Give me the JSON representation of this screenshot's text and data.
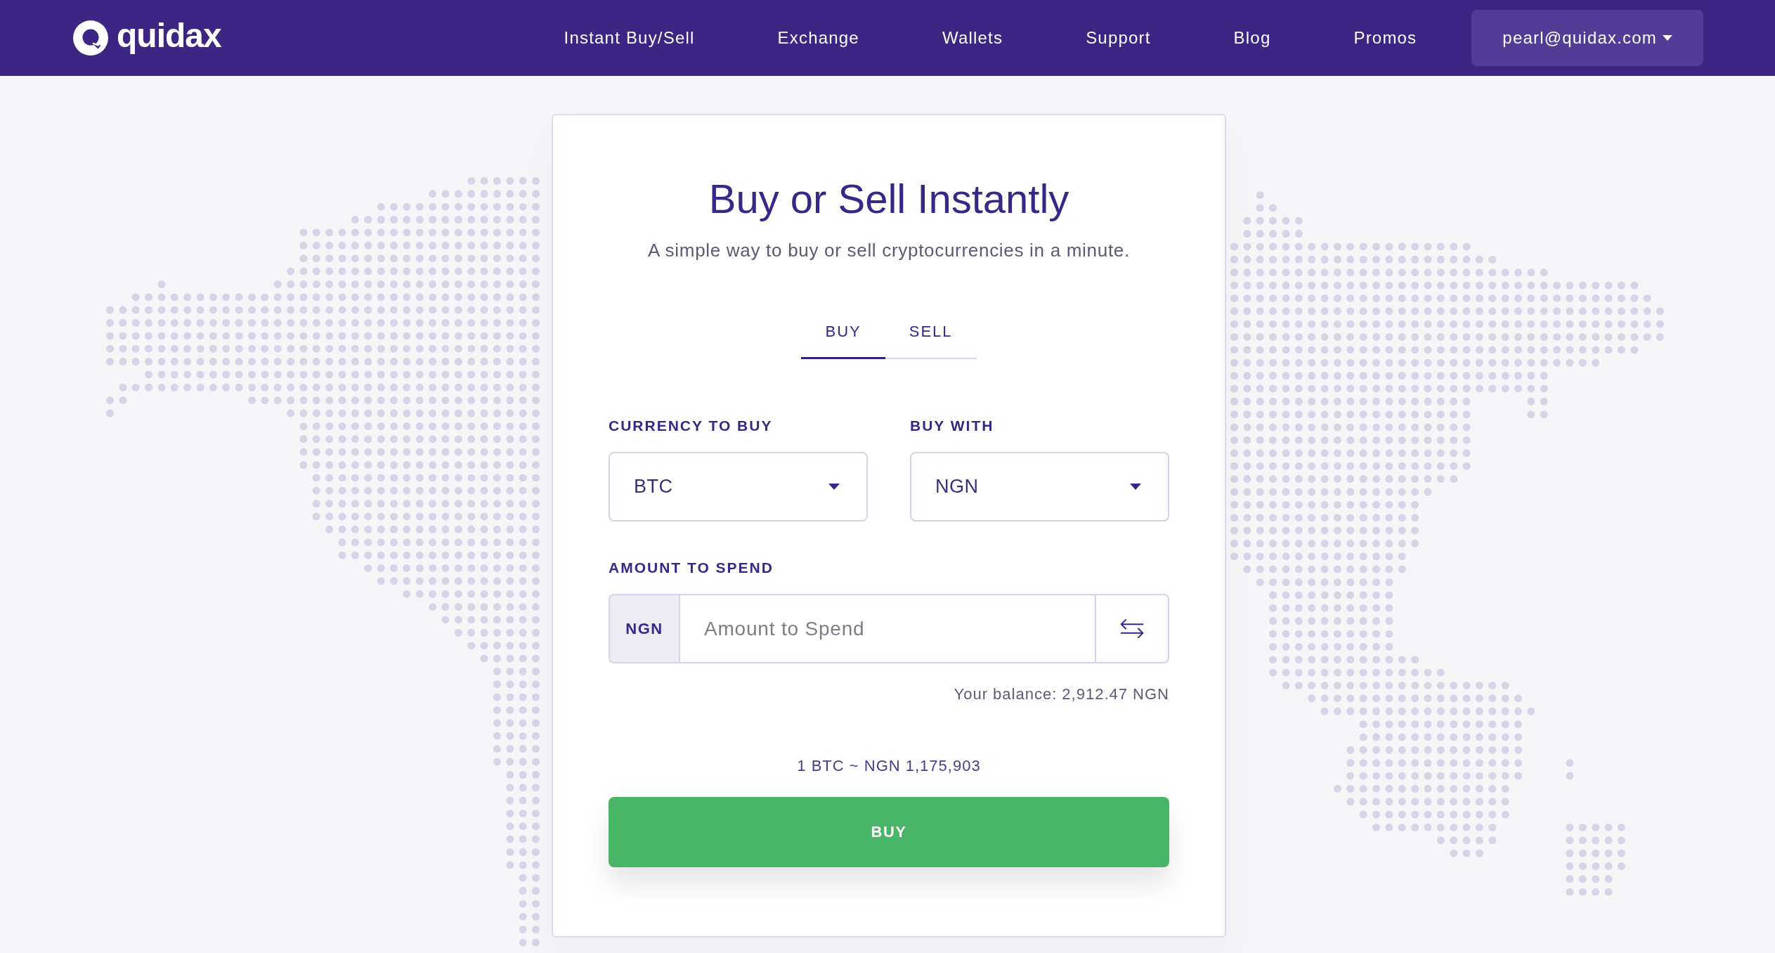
{
  "header": {
    "logo": "quidax",
    "nav": [
      "Instant Buy/Sell",
      "Exchange",
      "Wallets",
      "Support",
      "Blog",
      "Promos"
    ],
    "account": "pearl@quidax.com"
  },
  "card": {
    "title": "Buy or Sell Instantly",
    "subtitle": "A simple way to buy or sell cryptocurrencies in a minute.",
    "tabs": [
      {
        "label": "BUY",
        "selected": true
      },
      {
        "label": "SELL",
        "selected": false
      }
    ],
    "selects": [
      {
        "label": "CURRENCY TO BUY",
        "value": "BTC"
      },
      {
        "label": "BUY WITH",
        "value": "NGN"
      }
    ],
    "amount": {
      "label": "AMOUNT TO SPEND",
      "currency": "NGN",
      "placeholder": "Amount to Spend"
    },
    "balance": "Your balance: 2,912.47 NGN",
    "rate": "1 BTC ~ NGN 1,175,903",
    "submit": "BUY"
  }
}
